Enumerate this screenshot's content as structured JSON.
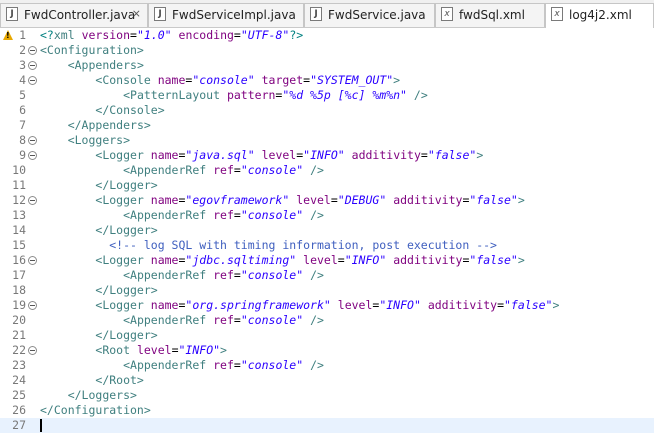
{
  "tabs": [
    {
      "label": "FwdController.java",
      "icon": "java-file-icon",
      "active": false,
      "closable": true
    },
    {
      "label": "FwdServiceImpl.java",
      "icon": "java-file-icon",
      "active": false
    },
    {
      "label": "FwdService.java",
      "icon": "java-file-icon",
      "active": false
    },
    {
      "label": "fwdSql.xml",
      "icon": "xml-file-icon",
      "active": false
    },
    {
      "label": "log4j2.xml",
      "icon": "xml-file-icon",
      "active": true
    }
  ],
  "icon_glyphs": {
    "java": "J",
    "xml": "x",
    "close": "⨯"
  },
  "colors": {
    "tag": "#3f7f7f",
    "attribute": "#7f007f",
    "value": "#2a00ff",
    "comment": "#3f5fbf",
    "line_number": "#787878",
    "current_line": "#e8f2fe",
    "warning": "#e8a800"
  },
  "lines": [
    {
      "num": "1",
      "warning": true,
      "fold": false,
      "tokens": [
        [
          "p",
          "<?"
        ],
        [
          "t",
          "xml "
        ],
        [
          "a",
          "version"
        ],
        [
          "x",
          "="
        ],
        [
          "v",
          "\"1.0\""
        ],
        [
          "x",
          " "
        ],
        [
          "a",
          "encoding"
        ],
        [
          "x",
          "="
        ],
        [
          "v",
          "\"UTF-8\""
        ],
        [
          "p",
          "?>"
        ]
      ]
    },
    {
      "num": "2",
      "fold": true,
      "tokens": [
        [
          "t",
          "<Configuration>"
        ]
      ]
    },
    {
      "num": "3",
      "fold": true,
      "tokens": [
        [
          "x",
          "    "
        ],
        [
          "t",
          "<Appenders>"
        ]
      ]
    },
    {
      "num": "4",
      "fold": true,
      "tokens": [
        [
          "x",
          "        "
        ],
        [
          "t",
          "<Console "
        ],
        [
          "a",
          "name"
        ],
        [
          "x",
          "="
        ],
        [
          "v",
          "\"console\""
        ],
        [
          "x",
          " "
        ],
        [
          "a",
          "target"
        ],
        [
          "x",
          "="
        ],
        [
          "v",
          "\"SYSTEM_OUT\""
        ],
        [
          "t",
          ">"
        ]
      ]
    },
    {
      "num": "5",
      "tokens": [
        [
          "x",
          "            "
        ],
        [
          "t",
          "<PatternLayout "
        ],
        [
          "a",
          "pattern"
        ],
        [
          "x",
          "="
        ],
        [
          "v",
          "\"%d %5p [%c] %m%n\""
        ],
        [
          "x",
          " "
        ],
        [
          "t",
          "/>"
        ]
      ]
    },
    {
      "num": "6",
      "tokens": [
        [
          "x",
          "        "
        ],
        [
          "t",
          "</Console>"
        ]
      ]
    },
    {
      "num": "7",
      "tokens": [
        [
          "x",
          "    "
        ],
        [
          "t",
          "</Appenders>"
        ]
      ]
    },
    {
      "num": "8",
      "fold": true,
      "tokens": [
        [
          "x",
          "    "
        ],
        [
          "t",
          "<Loggers>"
        ]
      ]
    },
    {
      "num": "9",
      "fold": true,
      "tokens": [
        [
          "x",
          "        "
        ],
        [
          "t",
          "<Logger "
        ],
        [
          "a",
          "name"
        ],
        [
          "x",
          "="
        ],
        [
          "v",
          "\"java.sql\""
        ],
        [
          "x",
          " "
        ],
        [
          "a",
          "level"
        ],
        [
          "x",
          "="
        ],
        [
          "v",
          "\"INFO\""
        ],
        [
          "x",
          " "
        ],
        [
          "a",
          "additivity"
        ],
        [
          "x",
          "="
        ],
        [
          "v",
          "\"false\""
        ],
        [
          "t",
          ">"
        ]
      ]
    },
    {
      "num": "10",
      "tokens": [
        [
          "x",
          "            "
        ],
        [
          "t",
          "<AppenderRef "
        ],
        [
          "a",
          "ref"
        ],
        [
          "x",
          "="
        ],
        [
          "v",
          "\"console\""
        ],
        [
          "x",
          " "
        ],
        [
          "t",
          "/>"
        ]
      ]
    },
    {
      "num": "11",
      "tokens": [
        [
          "x",
          "        "
        ],
        [
          "t",
          "</Logger>"
        ]
      ]
    },
    {
      "num": "12",
      "fold": true,
      "tokens": [
        [
          "x",
          "        "
        ],
        [
          "t",
          "<Logger "
        ],
        [
          "a",
          "name"
        ],
        [
          "x",
          "="
        ],
        [
          "v",
          "\"egovframework\""
        ],
        [
          "x",
          " "
        ],
        [
          "a",
          "level"
        ],
        [
          "x",
          "="
        ],
        [
          "v",
          "\"DEBUG\""
        ],
        [
          "x",
          " "
        ],
        [
          "a",
          "additivity"
        ],
        [
          "x",
          "="
        ],
        [
          "v",
          "\"false\""
        ],
        [
          "t",
          ">"
        ]
      ]
    },
    {
      "num": "13",
      "tokens": [
        [
          "x",
          "            "
        ],
        [
          "t",
          "<AppenderRef "
        ],
        [
          "a",
          "ref"
        ],
        [
          "x",
          "="
        ],
        [
          "v",
          "\"console\""
        ],
        [
          "x",
          " "
        ],
        [
          "t",
          "/>"
        ]
      ]
    },
    {
      "num": "14",
      "tokens": [
        [
          "x",
          "        "
        ],
        [
          "t",
          "</Logger>"
        ]
      ]
    },
    {
      "num": "15",
      "tokens": [
        [
          "x",
          "          "
        ],
        [
          "c",
          "<!-- log SQL with timing information, post execution -->"
        ]
      ]
    },
    {
      "num": "16",
      "fold": true,
      "tokens": [
        [
          "x",
          "        "
        ],
        [
          "t",
          "<Logger "
        ],
        [
          "a",
          "name"
        ],
        [
          "x",
          "="
        ],
        [
          "v",
          "\"jdbc.sqltiming\""
        ],
        [
          "x",
          " "
        ],
        [
          "a",
          "level"
        ],
        [
          "x",
          "="
        ],
        [
          "v",
          "\"INFO\""
        ],
        [
          "x",
          " "
        ],
        [
          "a",
          "additivity"
        ],
        [
          "x",
          "="
        ],
        [
          "v",
          "\"false\""
        ],
        [
          "t",
          ">"
        ]
      ]
    },
    {
      "num": "17",
      "tokens": [
        [
          "x",
          "            "
        ],
        [
          "t",
          "<AppenderRef "
        ],
        [
          "a",
          "ref"
        ],
        [
          "x",
          "="
        ],
        [
          "v",
          "\"console\""
        ],
        [
          "x",
          " "
        ],
        [
          "t",
          "/>"
        ]
      ]
    },
    {
      "num": "18",
      "tokens": [
        [
          "x",
          "        "
        ],
        [
          "t",
          "</Logger>"
        ]
      ]
    },
    {
      "num": "19",
      "fold": true,
      "tokens": [
        [
          "x",
          "        "
        ],
        [
          "t",
          "<Logger "
        ],
        [
          "a",
          "name"
        ],
        [
          "x",
          "="
        ],
        [
          "v",
          "\"org.springframework\""
        ],
        [
          "x",
          " "
        ],
        [
          "a",
          "level"
        ],
        [
          "x",
          "="
        ],
        [
          "v",
          "\"INFO\""
        ],
        [
          "x",
          " "
        ],
        [
          "a",
          "additivity"
        ],
        [
          "x",
          "="
        ],
        [
          "v",
          "\"false\""
        ],
        [
          "t",
          ">"
        ]
      ]
    },
    {
      "num": "20",
      "tokens": [
        [
          "x",
          "            "
        ],
        [
          "t",
          "<AppenderRef "
        ],
        [
          "a",
          "ref"
        ],
        [
          "x",
          "="
        ],
        [
          "v",
          "\"console\""
        ],
        [
          "x",
          " "
        ],
        [
          "t",
          "/>"
        ]
      ]
    },
    {
      "num": "21",
      "tokens": [
        [
          "x",
          "        "
        ],
        [
          "t",
          "</Logger>"
        ]
      ]
    },
    {
      "num": "22",
      "fold": true,
      "tokens": [
        [
          "x",
          "        "
        ],
        [
          "t",
          "<Root "
        ],
        [
          "a",
          "level"
        ],
        [
          "x",
          "="
        ],
        [
          "v",
          "\"INFO\""
        ],
        [
          "t",
          ">"
        ]
      ]
    },
    {
      "num": "23",
      "tokens": [
        [
          "x",
          "            "
        ],
        [
          "t",
          "<AppenderRef "
        ],
        [
          "a",
          "ref"
        ],
        [
          "x",
          "="
        ],
        [
          "v",
          "\"console\""
        ],
        [
          "x",
          " "
        ],
        [
          "t",
          "/>"
        ]
      ]
    },
    {
      "num": "24",
      "tokens": [
        [
          "x",
          "        "
        ],
        [
          "t",
          "</Root>"
        ]
      ]
    },
    {
      "num": "25",
      "tokens": [
        [
          "x",
          "    "
        ],
        [
          "t",
          "</Loggers>"
        ]
      ]
    },
    {
      "num": "26",
      "tokens": [
        [
          "t",
          "</Configuration>"
        ]
      ]
    },
    {
      "num": "27",
      "current": true,
      "tokens": []
    }
  ]
}
